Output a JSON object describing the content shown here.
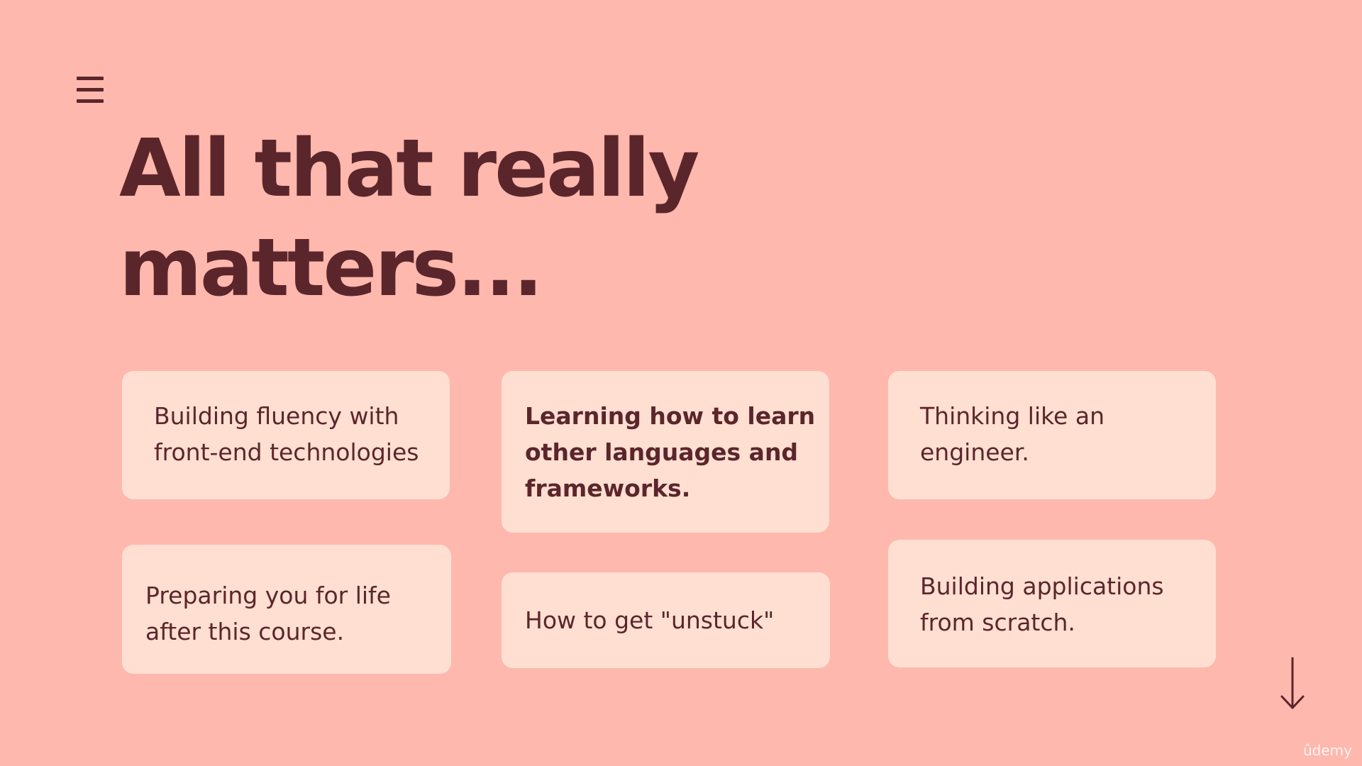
{
  "slide": {
    "title_lines": [
      "All that really",
      "matters..."
    ],
    "cards": [
      {
        "text": "Building fluency with front-end technologies",
        "lines": [
          "Building fluency with",
          "front-end technologies"
        ]
      },
      {
        "text": "Learning how to learn other languages and frameworks.",
        "lines": [
          "Learning how to learn",
          "other languages and",
          "frameworks."
        ]
      },
      {
        "text": "Thinking like an engineer.",
        "lines": [
          "Thinking like an",
          "engineer."
        ]
      },
      {
        "text": "Preparing you for life after this course.",
        "lines": [
          "Preparing you for life",
          "after this course."
        ]
      },
      {
        "text": "How to get \"unstuck\"",
        "lines": [
          "How to get \"unstuck\""
        ]
      },
      {
        "text": "Building applications from scratch.",
        "lines": [
          "Building applications",
          "from scratch."
        ]
      }
    ]
  },
  "icons": {
    "menu": "hamburger-menu-icon",
    "next": "arrow-down-icon"
  },
  "watermark": "ûdemy",
  "colors": {
    "background": "#ffb8ad",
    "card": "#ffdfd2",
    "text": "#5b262b"
  }
}
